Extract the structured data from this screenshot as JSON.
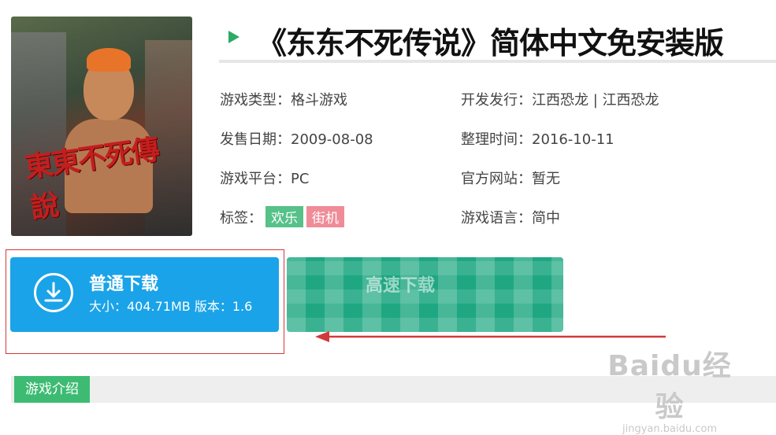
{
  "game": {
    "title": "《东东不死传说》简体中文免安装版",
    "cover_logo_text": "東東不死傳說"
  },
  "info": {
    "type_label": "游戏类型：",
    "type_value": "格斗游戏",
    "publisher_label": "开发发行：",
    "publisher_value": "江西恐龙 | 江西恐龙",
    "release_label": "发售日期：",
    "release_value": "2009-08-08",
    "organized_label": "整理时间：",
    "organized_value": "2016-10-11",
    "platform_label": "游戏平台：",
    "platform_value": "PC",
    "site_label": "官方网站：",
    "site_value": "暂无",
    "tags_label": "标签：",
    "tags": [
      "欢乐",
      "街机"
    ],
    "language_label": "游戏语言：",
    "language_value": "简中"
  },
  "download": {
    "normal_label": "普通下载",
    "normal_meta": "大小：404.71MB  版本：1.6",
    "fast_label": "高速下载"
  },
  "intro": {
    "tab_label": "游戏介绍"
  },
  "watermark": {
    "brand": "Baidu经验",
    "url": "jingyan.baidu.com"
  },
  "colors": {
    "accent_green": "#2dab66",
    "download_blue": "#1aa3e8",
    "fast_green": "#1fa782",
    "tag_green": "#56c189",
    "tag_pink": "#f08b98",
    "annotation_red": "#d23a3a"
  },
  "icons": {
    "title_marker": "triangle-right-icon",
    "download": "download-circle-icon"
  }
}
